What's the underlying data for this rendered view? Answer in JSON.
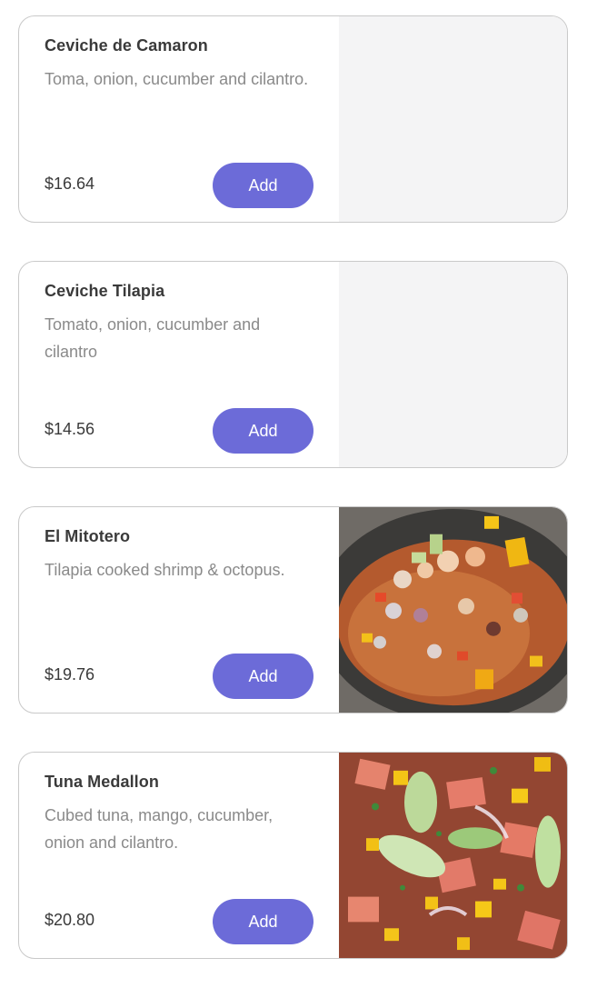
{
  "items": [
    {
      "name": "Ceviche de Camaron",
      "description": "Toma, onion, cucumber and cilantro.",
      "price": "$16.64",
      "add_label": "Add",
      "image": "none"
    },
    {
      "name": "Ceviche Tilapia",
      "description": "Tomato, onion, cucumber and cilantro",
      "price": "$14.56",
      "add_label": "Add",
      "image": "none"
    },
    {
      "name": "El Mitotero",
      "description": "Tilapia cooked shrimp & octopus.",
      "price": "$19.76",
      "add_label": "Add",
      "image": "seafood-cocktail-photo"
    },
    {
      "name": "Tuna Medallon",
      "description": "Cubed tuna, mango, cucumber, onion and cilantro.",
      "price": "$20.80",
      "add_label": "Add",
      "image": "tuna-ceviche-photo"
    }
  ],
  "colors": {
    "accent": "#6c6bd8",
    "placeholder_bg": "#f4f4f5",
    "title_text": "#3a3a3a",
    "description_text": "#8a8a8a",
    "card_border": "#c9c9c9"
  }
}
